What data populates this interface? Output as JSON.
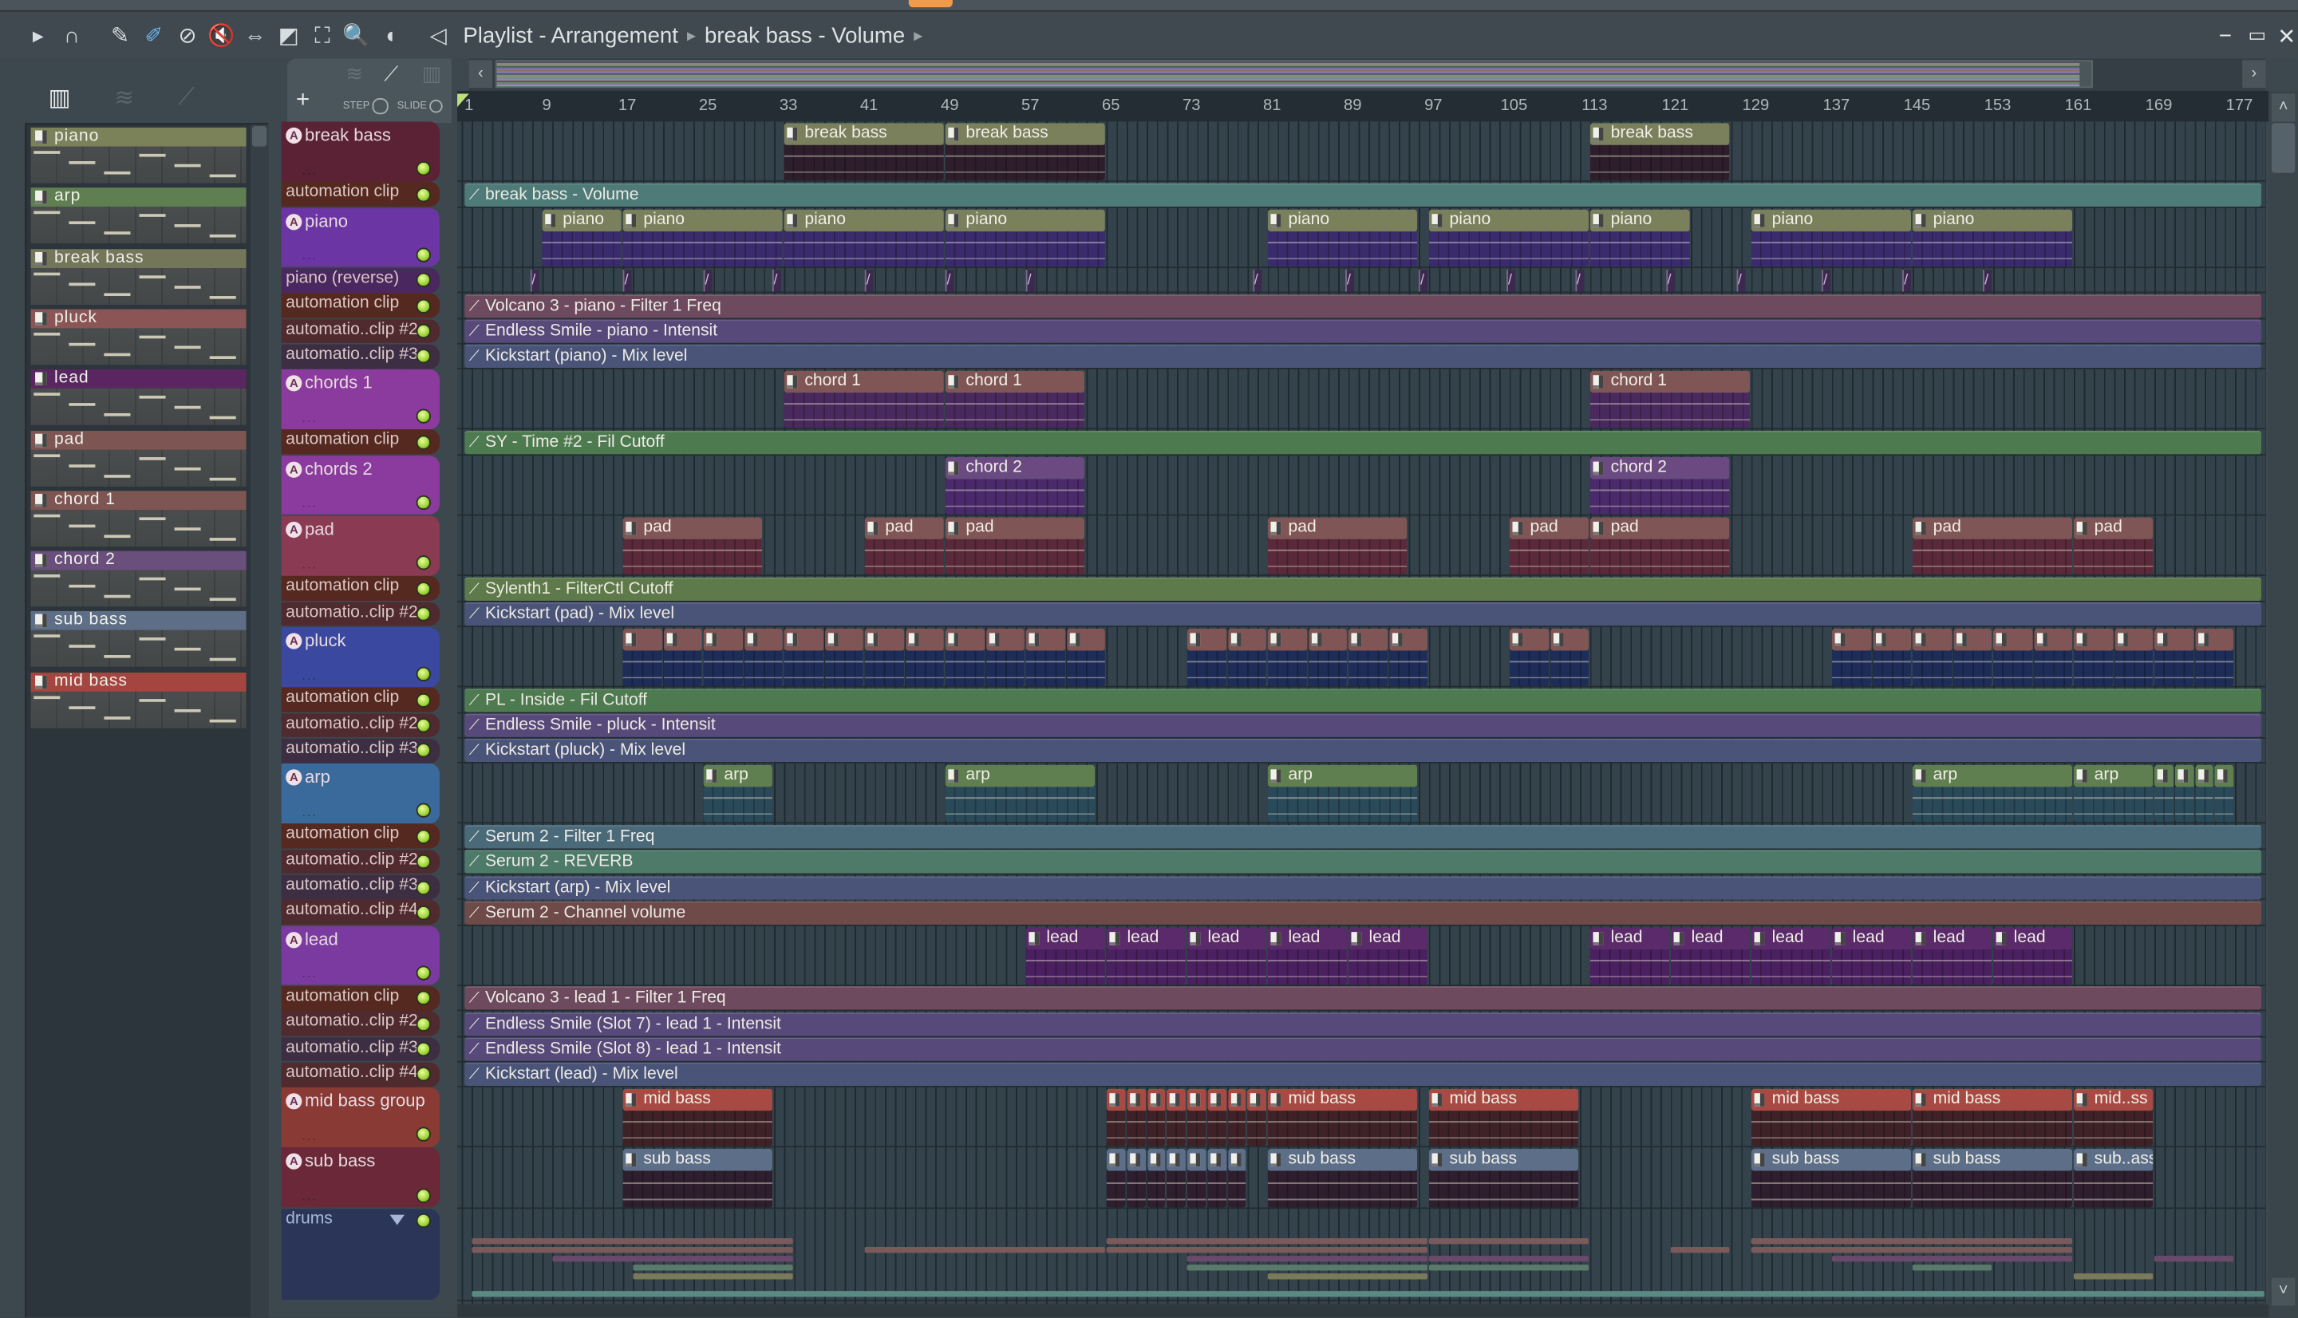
{
  "window": {
    "title": "Playlist - Arrangement",
    "breadcrumb": "break bass - Volume",
    "controls": {
      "minimize": "−",
      "maximize": "▭",
      "close": "✕"
    }
  },
  "toolbar": {
    "icons": [
      "play-arrow-icon",
      "magnet-icon",
      "pencil-icon",
      "paint-brush-icon",
      "delete-icon",
      "mute-icon",
      "slip-icon",
      "slice-icon",
      "select-icon",
      "zoom-icon",
      "playback-icon",
      "speaker-icon"
    ],
    "glyphs": [
      "▸",
      "∩",
      "✎",
      "✐",
      "⊘",
      "🔇",
      "⇔",
      "◩",
      "⛶",
      "🔍",
      "◖",
      "◁"
    ]
  },
  "picker": {
    "items": [
      {
        "label": "piano",
        "color": "#7b8159"
      },
      {
        "label": "arp",
        "color": "#5f7e52"
      },
      {
        "label": "break bass",
        "color": "#737659"
      },
      {
        "label": "pluck",
        "color": "#8a5554"
      },
      {
        "label": "lead",
        "color": "#5a2560"
      },
      {
        "label": "pad",
        "color": "#7d5552"
      },
      {
        "label": "chord 1",
        "color": "#7d5552"
      },
      {
        "label": "chord 2",
        "color": "#6a4f7c"
      },
      {
        "label": "sub bass",
        "color": "#5d6e86"
      },
      {
        "label": "mid bass",
        "color": "#a4463f"
      }
    ],
    "add_label": "+"
  },
  "overlay": {
    "add_label": "+",
    "step_label": "STEP",
    "slide_label": "SLIDE"
  },
  "ruler": {
    "bars": [
      1,
      9,
      17,
      25,
      33,
      41,
      49,
      57,
      65,
      73,
      81,
      89,
      97,
      105,
      113,
      121,
      129,
      137,
      145,
      153,
      161,
      169,
      177
    ]
  },
  "tracks": [
    {
      "name": "break bass",
      "kind": "inst",
      "color": "#5a2234",
      "ch": "#7a7f5c",
      "cb": "#2e1e2c",
      "clips": [
        {
          "s": 33,
          "l": 16,
          "label": "break bass"
        },
        {
          "s": 49,
          "l": 16,
          "label": "break bass"
        },
        {
          "s": 113,
          "l": 14,
          "label": "break bass"
        }
      ]
    },
    {
      "name": "automation clip",
      "kind": "auto",
      "color": "#55291f",
      "lane": "#4e7a78",
      "label": "break bass - Volume"
    },
    {
      "name": "piano",
      "kind": "inst",
      "color": "#6b35a3",
      "ch": "#7a7f5c",
      "cb": "#3a2c6c",
      "clips": [
        {
          "s": 9,
          "l": 8,
          "label": "piano"
        },
        {
          "s": 17,
          "l": 16,
          "label": "piano"
        },
        {
          "s": 33,
          "l": 16,
          "label": "piano"
        },
        {
          "s": 49,
          "l": 16,
          "label": "piano"
        },
        {
          "s": 81,
          "l": 15,
          "label": "piano"
        },
        {
          "s": 97,
          "l": 16,
          "label": "piano"
        },
        {
          "s": 113,
          "l": 10,
          "label": "piano"
        },
        {
          "s": 129,
          "l": 16,
          "label": "piano"
        },
        {
          "s": 145,
          "l": 16,
          "label": "piano"
        }
      ]
    },
    {
      "name": "piano (reverse)",
      "kind": "rev",
      "color": "#4b2760",
      "starts": [
        7.8,
        17,
        25,
        31.8,
        41,
        49,
        57,
        79.5,
        88.7,
        96,
        104.7,
        111.5,
        120.5,
        127.5,
        136,
        144,
        152
      ]
    },
    {
      "name": "automation clip",
      "kind": "auto",
      "color": "#55291f",
      "lane": "#6e4a5e",
      "label": "Volcano 3 - piano - Filter 1 Freq"
    },
    {
      "name": "automatio..clip #2",
      "kind": "auto",
      "color": "#4f2a2e",
      "lane": "#574a7a",
      "label": "Endless Smile - piano - Intensit"
    },
    {
      "name": "automatio..clip #3",
      "kind": "auto",
      "color": "#3e2e44",
      "lane": "#4a5478",
      "label": "Kickstart (piano) - Mix level"
    },
    {
      "name": "chords 1",
      "kind": "inst",
      "color": "#8b3b9d",
      "ch": "#7f5555",
      "cb": "#4a2a5e",
      "clips": [
        {
          "s": 33,
          "l": 16,
          "label": "chord 1"
        },
        {
          "s": 49,
          "l": 14,
          "label": "chord 1"
        },
        {
          "s": 113,
          "l": 16,
          "label": "chord 1"
        }
      ]
    },
    {
      "name": "automation clip",
      "kind": "auto",
      "color": "#55291f",
      "lane": "#4e7a50",
      "label": "SY - Time #2 - Fil Cutoff"
    },
    {
      "name": "chords 2",
      "kind": "inst",
      "color": "#8b3b9d",
      "ch": "#6a4a80",
      "cb": "#4a2a6a",
      "clips": [
        {
          "s": 49,
          "l": 14,
          "label": "chord 2"
        },
        {
          "s": 113,
          "l": 14,
          "label": "chord 2"
        }
      ]
    },
    {
      "name": "pad",
      "kind": "inst",
      "color": "#8a3a52",
      "ch": "#7f5555",
      "cb": "#5a2a3a",
      "clips": [
        {
          "s": 17,
          "l": 14,
          "label": "pad"
        },
        {
          "s": 41,
          "l": 8,
          "label": "pad"
        },
        {
          "s": 49,
          "l": 14,
          "label": "pad"
        },
        {
          "s": 81,
          "l": 14,
          "label": "pad"
        },
        {
          "s": 105,
          "l": 8,
          "label": "pad"
        },
        {
          "s": 113,
          "l": 14,
          "label": "pad"
        },
        {
          "s": 145,
          "l": 16,
          "label": "pad"
        },
        {
          "s": 161,
          "l": 8,
          "label": "pad"
        }
      ]
    },
    {
      "name": "automation clip",
      "kind": "auto",
      "color": "#55291f",
      "lane": "#5e7a4a",
      "label": "Sylenth1 - FilterCtl Cutoff"
    },
    {
      "name": "automatio..clip #2",
      "kind": "auto",
      "color": "#4f2a2e",
      "lane": "#4a5478",
      "label": "Kickstart (pad) - Mix level"
    },
    {
      "name": "pluck",
      "kind": "inst",
      "color": "#3a48a0",
      "ch": "#7f5555",
      "cb": "#1e2c58",
      "clips": [
        {
          "s": 17,
          "l": 4,
          "label": ""
        },
        {
          "s": 21,
          "l": 4,
          "label": ""
        },
        {
          "s": 25,
          "l": 4,
          "label": ""
        },
        {
          "s": 29,
          "l": 4,
          "label": ""
        },
        {
          "s": 33,
          "l": 4,
          "label": ""
        },
        {
          "s": 37,
          "l": 4,
          "label": ""
        },
        {
          "s": 41,
          "l": 4,
          "label": ""
        },
        {
          "s": 45,
          "l": 4,
          "label": ""
        },
        {
          "s": 49,
          "l": 4,
          "label": ""
        },
        {
          "s": 53,
          "l": 4,
          "label": ""
        },
        {
          "s": 57,
          "l": 4,
          "label": ""
        },
        {
          "s": 61,
          "l": 4,
          "label": ""
        },
        {
          "s": 73,
          "l": 4,
          "label": ""
        },
        {
          "s": 77,
          "l": 4,
          "label": ""
        },
        {
          "s": 81,
          "l": 4,
          "label": ""
        },
        {
          "s": 85,
          "l": 4,
          "label": ""
        },
        {
          "s": 89,
          "l": 4,
          "label": ""
        },
        {
          "s": 93,
          "l": 4,
          "label": ""
        },
        {
          "s": 105,
          "l": 4,
          "label": ""
        },
        {
          "s": 109,
          "l": 4,
          "label": ""
        },
        {
          "s": 137,
          "l": 4,
          "label": ""
        },
        {
          "s": 141,
          "l": 4,
          "label": ""
        },
        {
          "s": 145,
          "l": 4,
          "label": ""
        },
        {
          "s": 149,
          "l": 4,
          "label": ""
        },
        {
          "s": 153,
          "l": 4,
          "label": ""
        },
        {
          "s": 157,
          "l": 4,
          "label": ""
        },
        {
          "s": 161,
          "l": 4,
          "label": ""
        },
        {
          "s": 165,
          "l": 4,
          "label": ""
        },
        {
          "s": 169,
          "l": 4,
          "label": ""
        },
        {
          "s": 173,
          "l": 4,
          "label": ""
        }
      ]
    },
    {
      "name": "automation clip",
      "kind": "auto",
      "color": "#55291f",
      "lane": "#4e7a50",
      "label": "PL - Inside - Fil Cutoff"
    },
    {
      "name": "automatio..clip #2",
      "kind": "auto",
      "color": "#4f2a2e",
      "lane": "#574a7a",
      "label": "Endless Smile - pluck - Intensit"
    },
    {
      "name": "automatio..clip #3",
      "kind": "auto",
      "color": "#3e2e44",
      "lane": "#4a5478",
      "label": "Kickstart (pluck) - Mix level"
    },
    {
      "name": "arp",
      "kind": "inst",
      "color": "#3a6a9c",
      "ch": "#5f7f50",
      "cb": "#2a4a5a",
      "clips": [
        {
          "s": 25,
          "l": 7,
          "label": "arp"
        },
        {
          "s": 49,
          "l": 15,
          "label": "arp"
        },
        {
          "s": 81,
          "l": 15,
          "label": "arp"
        },
        {
          "s": 145,
          "l": 16,
          "label": "arp"
        },
        {
          "s": 161,
          "l": 8,
          "label": "arp"
        },
        {
          "s": 169,
          "l": 2,
          "label": ""
        },
        {
          "s": 171,
          "l": 2,
          "label": ""
        },
        {
          "s": 173,
          "l": 2,
          "label": ""
        },
        {
          "s": 175,
          "l": 2,
          "label": ""
        }
      ]
    },
    {
      "name": "automation clip",
      "kind": "auto",
      "color": "#55291f",
      "lane": "#4a6a7a",
      "label": "Serum 2 - Filter 1 Freq"
    },
    {
      "name": "automatio..clip #2",
      "kind": "auto",
      "color": "#4f2a2e",
      "lane": "#4e7a6a",
      "label": "Serum 2 - REVERB"
    },
    {
      "name": "automatio..clip #3",
      "kind": "auto",
      "color": "#3e2e44",
      "lane": "#4a5478",
      "label": "Kickstart (arp) - Mix level"
    },
    {
      "name": "automatio..clip #4",
      "kind": "auto",
      "color": "#4f2a2e",
      "lane": "#6e4a48",
      "label": "Serum 2 - Channel volume"
    },
    {
      "name": "lead",
      "kind": "inst",
      "color": "#7a3aa0",
      "ch": "#5a2a6a",
      "cb": "#4a2060",
      "clips": [
        {
          "s": 57,
          "l": 8,
          "label": "lead"
        },
        {
          "s": 65,
          "l": 8,
          "label": "lead"
        },
        {
          "s": 73,
          "l": 8,
          "label": "lead"
        },
        {
          "s": 81,
          "l": 8,
          "label": "lead"
        },
        {
          "s": 89,
          "l": 8,
          "label": "lead"
        },
        {
          "s": 113,
          "l": 8,
          "label": "lead"
        },
        {
          "s": 121,
          "l": 8,
          "label": "lead"
        },
        {
          "s": 129,
          "l": 8,
          "label": "lead"
        },
        {
          "s": 137,
          "l": 8,
          "label": "lead"
        },
        {
          "s": 145,
          "l": 8,
          "label": "lead"
        },
        {
          "s": 153,
          "l": 8,
          "label": "lead"
        }
      ]
    },
    {
      "name": "automation clip",
      "kind": "auto",
      "color": "#55291f",
      "lane": "#6e4a5e",
      "label": "Volcano 3 - lead 1 - Filter 1 Freq"
    },
    {
      "name": "automatio..clip #2",
      "kind": "auto",
      "color": "#4f2a2e",
      "lane": "#574a7a",
      "label": "Endless Smile (Slot 7) - lead 1 - Intensit"
    },
    {
      "name": "automatio..clip #3",
      "kind": "auto",
      "color": "#3e2e44",
      "lane": "#574a7a",
      "label": "Endless Smile (Slot 8) - lead 1 - Intensit"
    },
    {
      "name": "automatio..clip #4",
      "kind": "auto",
      "color": "#4f2a2e",
      "lane": "#4a5478",
      "label": "Kickstart (lead) - Mix level"
    },
    {
      "name": "mid bass group",
      "kind": "inst",
      "color": "#8a3a34",
      "ch": "#a84a44",
      "cb": "#3e2228",
      "clips": [
        {
          "s": 17,
          "l": 15,
          "label": "mid bass"
        },
        {
          "s": 65,
          "l": 2,
          "label": ""
        },
        {
          "s": 67,
          "l": 2,
          "label": ""
        },
        {
          "s": 69,
          "l": 2,
          "label": ""
        },
        {
          "s": 71,
          "l": 2,
          "label": ""
        },
        {
          "s": 73,
          "l": 2,
          "label": ""
        },
        {
          "s": 75,
          "l": 2,
          "label": ""
        },
        {
          "s": 77,
          "l": 2,
          "label": ""
        },
        {
          "s": 79,
          "l": 2,
          "label": ""
        },
        {
          "s": 81,
          "l": 15,
          "label": "mid bass"
        },
        {
          "s": 97,
          "l": 15,
          "label": "mid bass"
        },
        {
          "s": 129,
          "l": 16,
          "label": "mid bass"
        },
        {
          "s": 145,
          "l": 16,
          "label": "mid bass"
        },
        {
          "s": 161,
          "l": 8,
          "label": "mid..ss"
        }
      ]
    },
    {
      "name": "sub bass",
      "kind": "inst",
      "color": "#6a2838",
      "ch": "#5c6e88",
      "cb": "#2e1e2e",
      "clips": [
        {
          "s": 17,
          "l": 15,
          "label": "sub bass"
        },
        {
          "s": 65,
          "l": 2,
          "label": ""
        },
        {
          "s": 67,
          "l": 2,
          "label": ""
        },
        {
          "s": 69,
          "l": 2,
          "label": ""
        },
        {
          "s": 71,
          "l": 2,
          "label": ""
        },
        {
          "s": 73,
          "l": 2,
          "label": ""
        },
        {
          "s": 75,
          "l": 2,
          "label": ""
        },
        {
          "s": 77,
          "l": 2,
          "label": ""
        },
        {
          "s": 81,
          "l": 15,
          "label": "sub bass"
        },
        {
          "s": 97,
          "l": 15,
          "label": "sub bass"
        },
        {
          "s": 129,
          "l": 16,
          "label": "sub bass"
        },
        {
          "s": 145,
          "l": 16,
          "label": "sub bass"
        },
        {
          "s": 161,
          "l": 8,
          "label": "sub..ass"
        }
      ]
    },
    {
      "name": "drums",
      "kind": "group",
      "color": "#2b3558"
    }
  ],
  "drums": {
    "clips": [
      {
        "row": 0,
        "s": 2,
        "l": 32,
        "c": "#7a5a5a"
      },
      {
        "row": 1,
        "s": 2,
        "l": 32,
        "c": "#7a5a5a"
      },
      {
        "row": 2,
        "s": 10,
        "l": 24,
        "c": "#6a4a6a"
      },
      {
        "row": 3,
        "s": 18,
        "l": 16,
        "c": "#5a7a6a"
      },
      {
        "row": 4,
        "s": 18,
        "l": 16,
        "c": "#7a7a5a"
      },
      {
        "row": 1,
        "s": 41,
        "l": 24,
        "c": "#7a5a5a"
      },
      {
        "row": 0,
        "s": 65,
        "l": 32,
        "c": "#7a5a5a"
      },
      {
        "row": 1,
        "s": 65,
        "l": 32,
        "c": "#7a5a5a"
      },
      {
        "row": 2,
        "s": 73,
        "l": 24,
        "c": "#6a4a6a"
      },
      {
        "row": 3,
        "s": 73,
        "l": 24,
        "c": "#5a7a6a"
      },
      {
        "row": 4,
        "s": 81,
        "l": 16,
        "c": "#7a7a5a"
      },
      {
        "row": 0,
        "s": 97,
        "l": 16,
        "c": "#7a5a5a"
      },
      {
        "row": 2,
        "s": 97,
        "l": 16,
        "c": "#6a4a6a"
      },
      {
        "row": 3,
        "s": 97,
        "l": 16,
        "c": "#5a7a6a"
      },
      {
        "row": 1,
        "s": 121,
        "l": 6,
        "c": "#7a5a5a"
      },
      {
        "row": 0,
        "s": 129,
        "l": 32,
        "c": "#7a5a5a"
      },
      {
        "row": 1,
        "s": 129,
        "l": 32,
        "c": "#7a5a5a"
      },
      {
        "row": 2,
        "s": 137,
        "l": 24,
        "c": "#6a4a6a"
      },
      {
        "row": 3,
        "s": 145,
        "l": 8,
        "c": "#5a7a6a"
      },
      {
        "row": 4,
        "s": 161,
        "l": 8,
        "c": "#7a7a5a"
      },
      {
        "row": 2,
        "s": 169,
        "l": 8,
        "c": "#6a4a6a"
      },
      {
        "row": 6,
        "s": 2,
        "l": 178,
        "c": "#5a8a84"
      }
    ]
  },
  "colors": {
    "grid": "#34434b",
    "ruler": "#242d33",
    "playhead": "#bde07a",
    "led": "#9ed23a"
  }
}
